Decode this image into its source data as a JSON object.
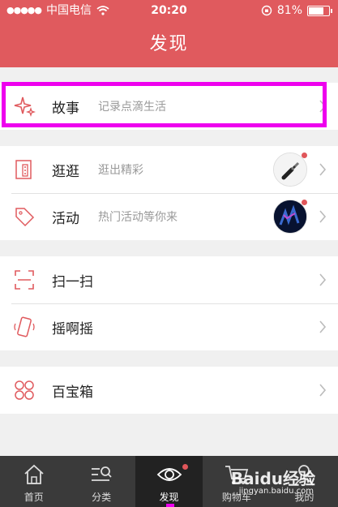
{
  "status_bar": {
    "carrier": "中国电信",
    "time": "20:20",
    "battery": "81%",
    "battery_level": 0.81
  },
  "header": {
    "title": "发现"
  },
  "sections": [
    {
      "items": [
        {
          "label": "故事",
          "subtitle": "记录点滴生活",
          "icon": "sparkle-icon"
        }
      ]
    },
    {
      "items": [
        {
          "label": "逛逛",
          "subtitle": "逛出精彩",
          "icon": "store-icon",
          "thumbnail": "earphone-plug-thumbnail",
          "has_badge": true
        },
        {
          "label": "活动",
          "subtitle": "热门活动等你来",
          "icon": "tag-icon",
          "thumbnail": "dark-blue-event-thumbnail",
          "has_badge": true
        }
      ]
    },
    {
      "items": [
        {
          "label": "扫一扫",
          "icon": "scan-icon"
        },
        {
          "label": "摇啊摇",
          "icon": "shake-phone-icon"
        }
      ]
    },
    {
      "items": [
        {
          "label": "百宝箱",
          "icon": "four-circles-icon"
        }
      ]
    }
  ],
  "tab_bar": {
    "tabs": [
      {
        "label": "首页",
        "icon": "home-icon",
        "active": false
      },
      {
        "label": "分类",
        "icon": "category-search-icon",
        "active": false
      },
      {
        "label": "发现",
        "icon": "eye-icon",
        "active": true,
        "has_badge": true
      },
      {
        "label": "购物车",
        "icon": "cart-icon",
        "active": false
      },
      {
        "label": "我的",
        "icon": "user-icon",
        "active": false
      }
    ]
  },
  "watermark": {
    "text": "Baidu经验",
    "sub": "jingyan.baidu.com"
  },
  "colors": {
    "brand": "#e05a5e",
    "highlight": "#ee00ee",
    "tabbar": "#3a3a3a"
  }
}
